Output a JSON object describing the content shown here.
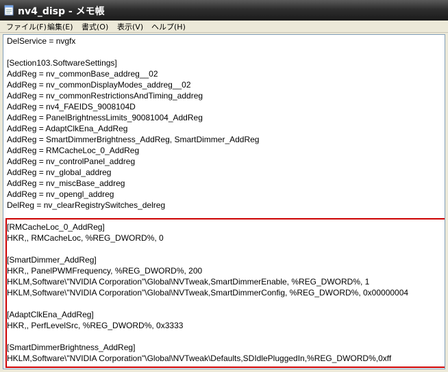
{
  "window": {
    "title": "nv4_disp - メモ帳",
    "icon": "notepad-icon"
  },
  "menu": [
    {
      "label": "ファイル(F)"
    },
    {
      "label": "編集(E)"
    },
    {
      "label": "書式(O)"
    },
    {
      "label": "表示(V)"
    },
    {
      "label": "ヘルプ(H)"
    }
  ],
  "editor": {
    "lines": [
      "DelService = nvgfx",
      "",
      "[Section103.SoftwareSettings]",
      "AddReg = nv_commonBase_addreg__02",
      "AddReg = nv_commonDisplayModes_addreg__02",
      "AddReg = nv_commonRestrictionsAndTiming_addreg",
      "AddReg = nv4_FAEIDS_9008104D",
      "AddReg = PanelBrightnessLimits_90081004_AddReg",
      "AddReg = AdaptClkEna_AddReg",
      "AddReg = SmartDimmerBrightness_AddReg, SmartDimmer_AddReg",
      "AddReg = RMCacheLoc_0_AddReg",
      "AddReg = nv_controlPanel_addreg",
      "AddReg = nv_global_addreg",
      "AddReg = nv_miscBase_addreg",
      "AddReg = nv_opengl_addreg",
      "DelReg = nv_clearRegistrySwitches_delreg",
      "",
      "[RMCacheLoc_0_AddReg]",
      "HKR,, RMCacheLoc, %REG_DWORD%, 0",
      "",
      "[SmartDimmer_AddReg]",
      "HKR,, PanelPWMFrequency, %REG_DWORD%, 200",
      "HKLM,Software\\\"NVIDIA Corporation\"\\Global\\NVTweak,SmartDimmerEnable, %REG_DWORD%, 1",
      "HKLM,Software\\\"NVIDIA Corporation\"\\Global\\NVTweak,SmartDimmerConfig, %REG_DWORD%, 0x00000004",
      "",
      "[AdaptClkEna_AddReg]",
      "HKR,, PerfLevelSrc, %REG_DWORD%, 0x3333",
      "",
      "[SmartDimmerBrightness_AddReg]",
      "HKLM,Software\\\"NVIDIA Corporation\"\\Global\\NVTweak\\Defaults,SDIdlePluggedIn,%REG_DWORD%,0xff"
    ]
  },
  "colors": {
    "highlight_border": "#cc0000",
    "titlebar": "#2e2e2e",
    "window_bg": "#ece9d8"
  }
}
